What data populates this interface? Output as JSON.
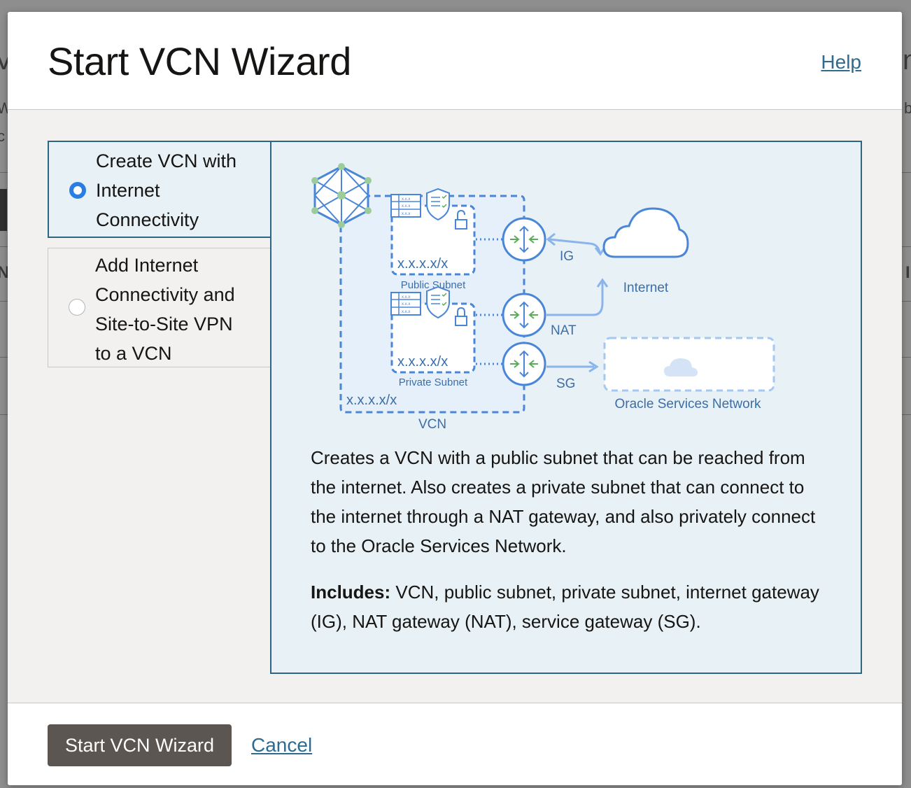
{
  "dialog": {
    "title": "Start VCN Wizard",
    "help_label": "Help"
  },
  "options": [
    {
      "lines": [
        "Create VCN with",
        "Internet",
        "Connectivity"
      ],
      "selected": true
    },
    {
      "lines": [
        "Add Internet",
        "Connectivity and",
        "Site-to-Site VPN",
        "to a VCN"
      ],
      "selected": false
    }
  ],
  "diagram": {
    "public_cidr": "x.x.x.x/x",
    "public_subnet_label": "Public Subnet",
    "private_cidr": "x.x.x.x/x",
    "private_subnet_label": "Private Subnet",
    "vcn_cidr": "x.x.x.x/x",
    "vcn_label": "VCN",
    "ig_label": "IG",
    "nat_label": "NAT",
    "sg_label": "SG",
    "internet_label": "Internet",
    "osn_label": "Oracle Services Network",
    "table_cell_text": "x.x.x",
    "colors": {
      "line_blue": "#4a86d8",
      "light_blue": "#8ab4ec",
      "arrow_green": "#5aaa5a",
      "node_green": "#9ccc9a",
      "text_blue": "#3c6ea8"
    }
  },
  "description": "Creates a VCN with a public subnet that can be reached from the internet. Also creates a private subnet that can connect to the internet through a NAT gateway, and also privately connect to the Oracle Services Network.",
  "includes": {
    "label": "Includes:",
    "text": " VCN, public subnet, private subnet, internet gateway (IG), NAT gateway (NAT), service gateway (SG)."
  },
  "footer": {
    "primary_label": "Start VCN Wizard",
    "cancel_label": "Cancel"
  },
  "background_fragments": [
    "Vi",
    "W",
    "c",
    "N",
    "n",
    "b",
    "I"
  ]
}
